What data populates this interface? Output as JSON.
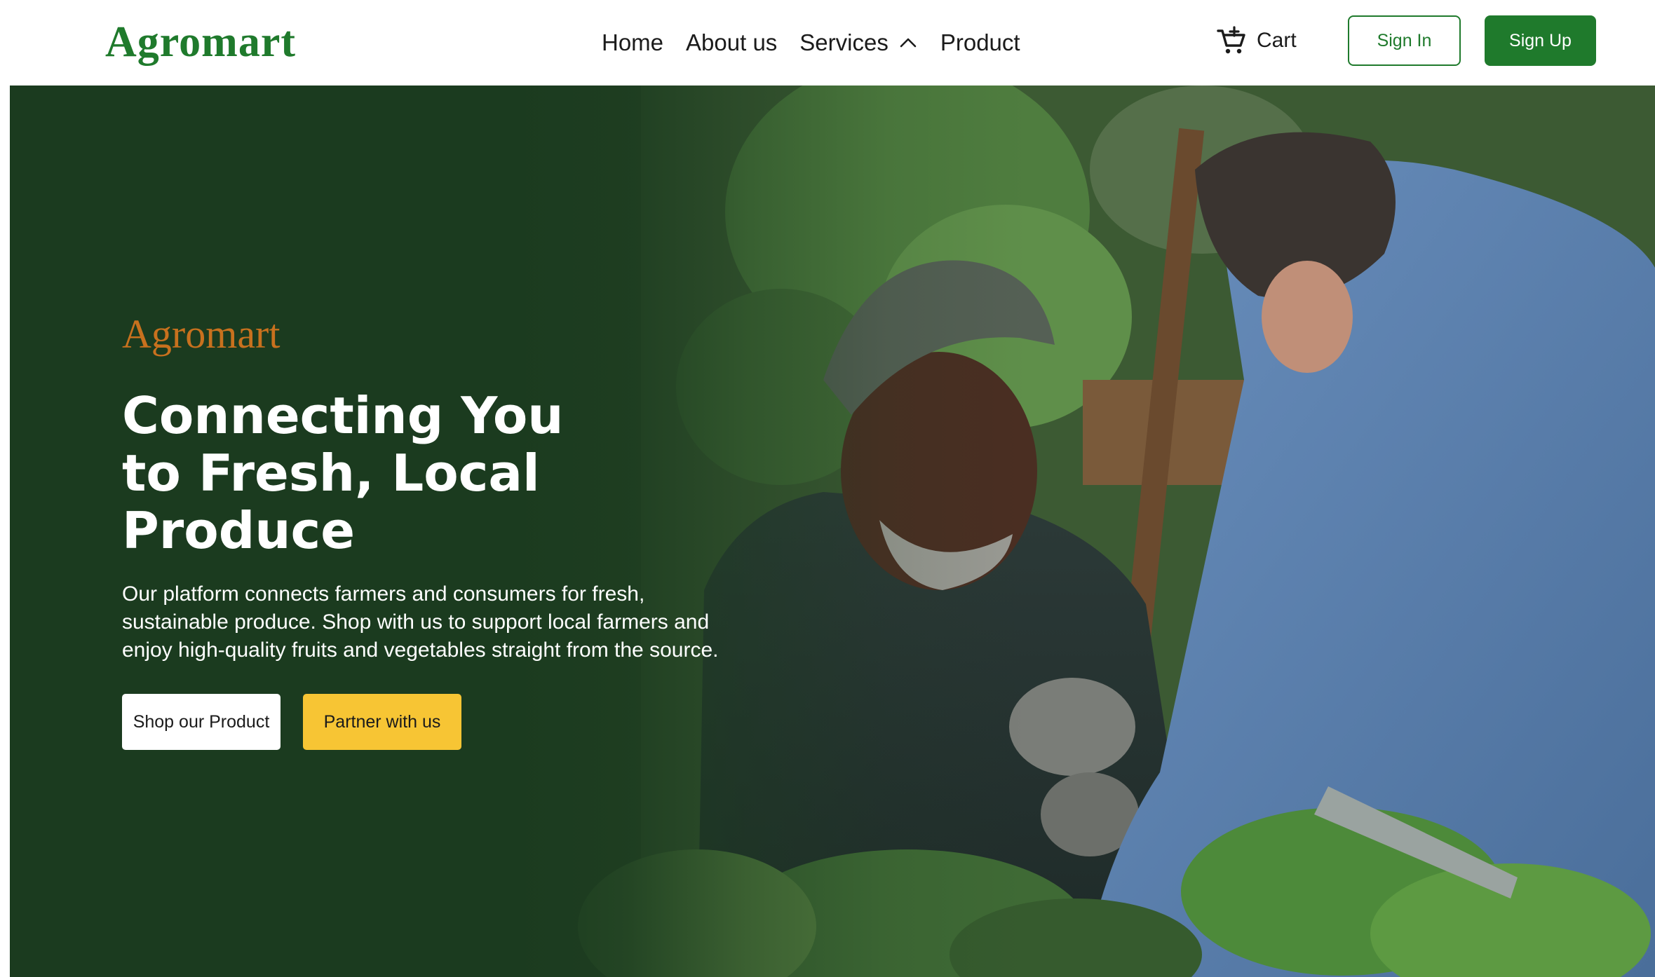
{
  "navbar": {
    "logo": "Agromart",
    "links": [
      {
        "label": "Home"
      },
      {
        "label": "About us"
      },
      {
        "label": "Services"
      },
      {
        "label": "Product"
      }
    ],
    "cart_label": "Cart",
    "sign_in_label": "Sign In",
    "sign_up_label": "Sign Up"
  },
  "hero": {
    "brand": "Agromart",
    "heading": "Connecting You to Fresh, Local Produce",
    "description": "Our platform connects farmers and consumers for fresh, sustainable produce. Shop with us to support local farmers and enjoy high-quality fruits and vegetables straight from the source.",
    "shop_button_label": "Shop our Product",
    "partner_button_label": "Partner with us"
  },
  "colors": {
    "brand_green": "#1f7a2c",
    "hero_bg": "#1b3b1f",
    "brand_orange": "#c8711e",
    "accent_yellow": "#f7c534"
  },
  "icons": {
    "services_toggle": "chevron-up-icon",
    "cart": "cart-icon"
  }
}
